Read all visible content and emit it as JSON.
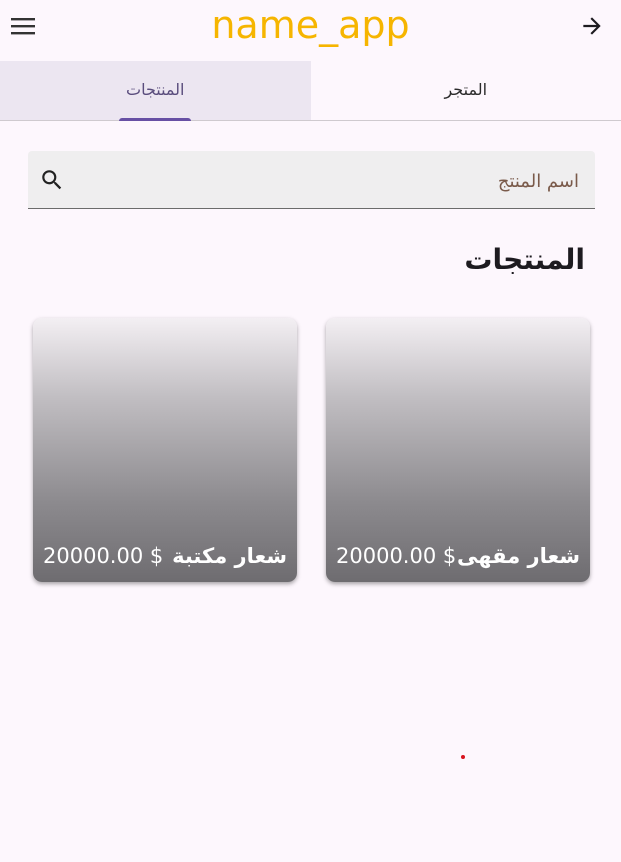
{
  "appbar": {
    "title": "name_app",
    "menu_icon": "menu-icon",
    "back_icon": "arrow-forward-icon",
    "title_color": "#f6b500"
  },
  "tabs": [
    {
      "label": "المنتجات",
      "active": true
    },
    {
      "label": "المتجر",
      "active": false
    }
  ],
  "search": {
    "placeholder": "اسم المنتج",
    "value": "",
    "icon": "search-icon"
  },
  "section": {
    "title": "المنتجات"
  },
  "products": [
    {
      "name": "شعار مقهى",
      "price": "20000.00 $"
    },
    {
      "name": "شعار مكتبة",
      "price": "20000.00 $"
    }
  ],
  "colors": {
    "accent": "#6750a4",
    "background": "#fdf7fd"
  }
}
